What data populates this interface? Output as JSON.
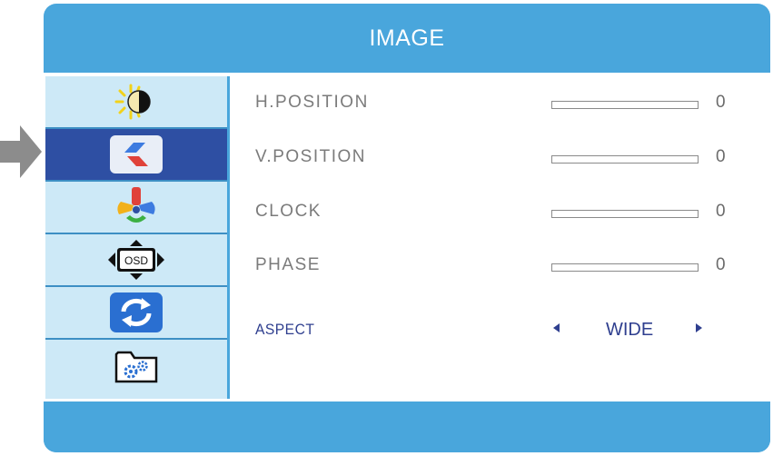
{
  "osd": {
    "title": "IMAGE"
  },
  "sidebar": {
    "items": [
      {
        "icon": "brightness-icon",
        "selected": false
      },
      {
        "icon": "image-setup-icon",
        "selected": true
      },
      {
        "icon": "color-icon",
        "selected": false
      },
      {
        "icon": "osd-icon",
        "icon_text": "OSD",
        "selected": false
      },
      {
        "icon": "reset-icon",
        "selected": false
      },
      {
        "icon": "misc-settings-icon",
        "selected": false
      }
    ]
  },
  "settings": {
    "rows": [
      {
        "label": "H.POSITION",
        "value": "0"
      },
      {
        "label": "V.POSITION",
        "value": "0"
      },
      {
        "label": "CLOCK",
        "value": "0"
      },
      {
        "label": "PHASE",
        "value": "0"
      }
    ],
    "aspect": {
      "label": "ASPECT",
      "value": "WIDE"
    }
  },
  "colors": {
    "frame": "#49a6dc",
    "sidebar_bg": "#cde9f7",
    "selected_bg": "#2e4fa3",
    "label_gray": "#7b7b7b",
    "aspect_blue": "#2f3f8f",
    "pointer_gray": "#8c8c8c"
  }
}
